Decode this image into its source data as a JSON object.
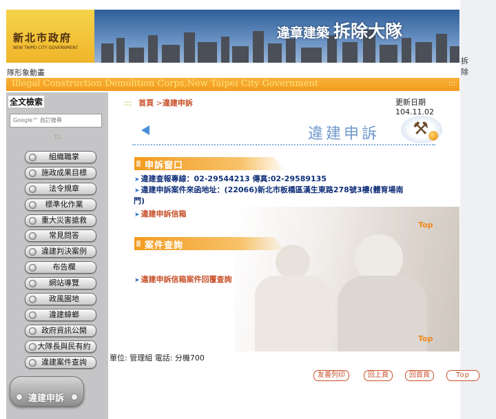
{
  "banner": {
    "org_cn": "新北市政府",
    "org_en": "NEW TAIPEI CITY GOVERNMENT",
    "title_small": "違章建築",
    "title_big": "拆除大隊",
    "tail_right": "拆除",
    "tail_left": "隊形象動畫"
  },
  "en_bar": {
    "text": "Illegal Construction Demolition Corps,New Taipei City Government",
    "dots": ":::"
  },
  "sidebar": {
    "search_title": "全文檢索",
    "search_placeholder": "Google™ 自訂搜尋",
    "dots": ":::",
    "items": [
      {
        "label": "組織職掌"
      },
      {
        "label": "施政成果目標"
      },
      {
        "label": "法令規章"
      },
      {
        "label": "標準化作業"
      },
      {
        "label": "重大災害搶救"
      },
      {
        "label": "常見問答"
      },
      {
        "label": "違建判決案例"
      },
      {
        "label": "布告欄"
      },
      {
        "label": "網站導覽"
      },
      {
        "label": "政風園地"
      },
      {
        "label": "違建蟑螂"
      },
      {
        "label": "政府資訊公開"
      },
      {
        "label": "大隊長與民有約"
      },
      {
        "label": "違建案件查詢"
      }
    ],
    "badge_label": "違建申訴"
  },
  "main": {
    "breadcrumb": {
      "dots": ":::",
      "home": "首頁",
      "sep": ">",
      "current": "違建申訴"
    },
    "updated": "更新日期 104.11.02",
    "header_title": "違建申訴",
    "section1": {
      "title": "申訴窗口",
      "lines": [
        "違建查報專線：02-29544213 傳真:02-29589135",
        "違建申訴案件來函地址：(22066)新北市板橋區漢生東路278號3樓(體育場南",
        "門)",
        "違建申訴信箱"
      ]
    },
    "section2": {
      "title": "案件查詢",
      "lines": [
        "違建申訴信箱案件回覆查詢"
      ]
    },
    "top_label": "Top",
    "unit_text": "單位: 管理組  電話: 分機700",
    "buttons": {
      "print": "友善列印",
      "prev": "回上頁",
      "home": "回首頁",
      "top": "Top"
    }
  }
}
